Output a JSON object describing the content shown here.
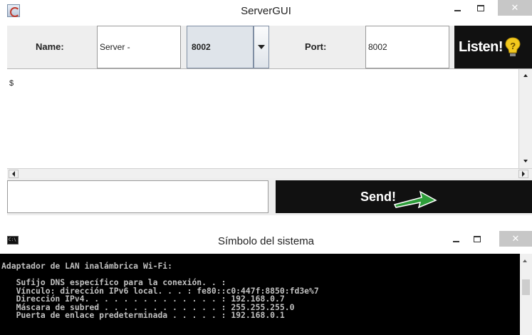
{
  "server_window": {
    "title": "ServerGUI",
    "name_label": "Name:",
    "name_value": "Server -",
    "port_combo_value": "8002",
    "port_label": "Port:",
    "port_value": "8002",
    "listen_label": "Listen!",
    "console_text": "$",
    "message_input_value": "",
    "send_label": "Send!"
  },
  "cmd_window": {
    "title": "Símbolo del sistema",
    "lines": [
      "Adaptador de LAN inalámbrica Wi-Fi:",
      "",
      "   Sufijo DNS específico para la conexión. . :",
      "   Vínculo: dirección IPv6 local. . . : fe80::c0:447f:8850:fd3e%7",
      "   Dirección IPv4. . . . . . . . . . . . . . : 192.168.0.7",
      "   Máscara de subred . . . . . . . . . . . . : 255.255.255.0",
      "   Puerta de enlace predeterminada . . . . . : 192.168.0.1"
    ]
  },
  "colors": {
    "dark_button": "#111111",
    "send_arrow_green": "#2e9e3a",
    "listen_icon_yellow": "#f2c81e",
    "console_bg": "#000000",
    "console_fg": "#c0c0c0"
  },
  "icons": [
    "java-app-icon",
    "cmd-app-icon",
    "minimize-icon",
    "maximize-icon",
    "close-icon",
    "question-bulb-icon",
    "send-arrow-icon",
    "chevron-down-icon"
  ]
}
